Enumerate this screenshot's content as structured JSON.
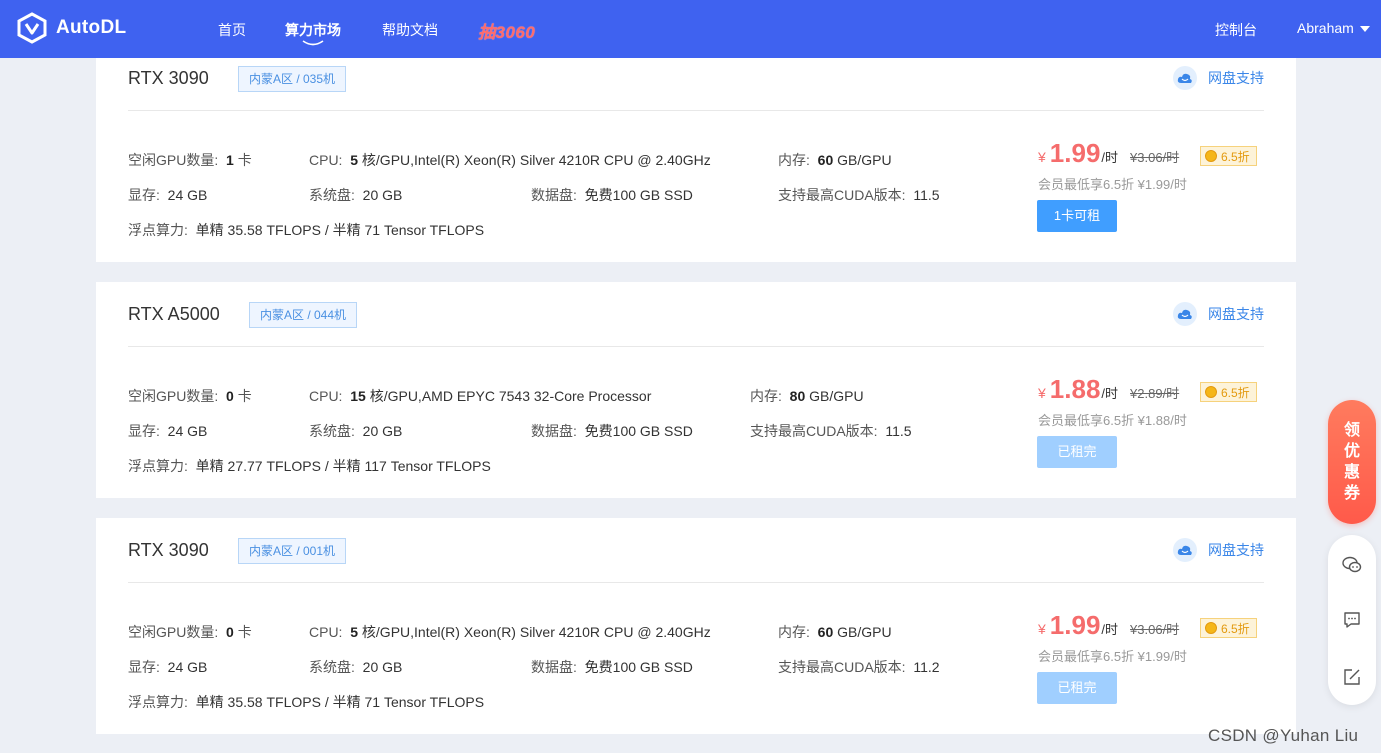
{
  "header": {
    "brand": "AutoDL",
    "nav": [
      {
        "label": "首页"
      },
      {
        "label": "算力市场"
      },
      {
        "label": "帮助文档"
      }
    ],
    "promo": "抽3060",
    "console": "控制台",
    "user": "Abraham"
  },
  "labels": {
    "idle_gpu": "空闲GPU数量:",
    "gpu_unit": "卡",
    "cpu": "CPU:",
    "cpu_unit": "核/GPU,",
    "memory": "内存:",
    "per_gpu": "GB/GPU",
    "vram": "显存:",
    "system_disk": "系统盘:",
    "data_disk": "数据盘:",
    "cuda": "支持最高CUDA版本:",
    "flops": "浮点算力:",
    "disk_support": "网盘支持",
    "price_unit": "/时"
  },
  "cards": [
    {
      "gpu": "RTX 3090",
      "region": "内蒙A区 / 035机",
      "idle": "1",
      "cpu_cores": "5",
      "cpu_model": "Intel(R) Xeon(R) Silver 4210R CPU @ 2.40GHz",
      "mem": "60",
      "vram": "24 GB",
      "sys_disk": "20 GB",
      "data_disk": "免费100 GB SSD",
      "cuda": "11.5",
      "flops": "单精 35.58 TFLOPS / 半精 71 Tensor TFLOPS",
      "price": "1.99",
      "orig": "¥3.06/时",
      "discount": "6.5折",
      "member": "会员最低享6.5折 ¥1.99/时",
      "button": "1卡可租",
      "available": true
    },
    {
      "gpu": "RTX A5000",
      "region": "内蒙A区 / 044机",
      "idle": "0",
      "cpu_cores": "15",
      "cpu_model": "AMD EPYC 7543 32-Core Processor",
      "mem": "80",
      "vram": "24 GB",
      "sys_disk": "20 GB",
      "data_disk": "免费100 GB SSD",
      "cuda": "11.5",
      "flops": "单精 27.77 TFLOPS / 半精 117 Tensor TFLOPS",
      "price": "1.88",
      "orig": "¥2.89/时",
      "discount": "6.5折",
      "member": "会员最低享6.5折 ¥1.88/时",
      "button": "已租完",
      "available": false
    },
    {
      "gpu": "RTX 3090",
      "region": "内蒙A区 / 001机",
      "idle": "0",
      "cpu_cores": "5",
      "cpu_model": "Intel(R) Xeon(R) Silver 4210R CPU @ 2.40GHz",
      "mem": "60",
      "vram": "24 GB",
      "sys_disk": "20 GB",
      "data_disk": "免费100 GB SSD",
      "cuda": "11.2",
      "flops": "单精 35.58 TFLOPS / 半精 71 Tensor TFLOPS",
      "price": "1.99",
      "orig": "¥3.06/时",
      "discount": "6.5折",
      "member": "会员最低享6.5折 ¥1.99/时",
      "button": "已租完",
      "available": false
    }
  ],
  "sidebar": {
    "coupon": [
      "领",
      "优",
      "惠",
      "券"
    ],
    "tools": [
      "wechat-icon",
      "feedback-icon",
      "edit-icon"
    ]
  },
  "watermark": "CSDN @Yuhan Liu",
  "colors": {
    "header": "#3f62f0",
    "price": "#f56c6c",
    "button": "#409eff",
    "button_disabled": "#a0cfff"
  }
}
